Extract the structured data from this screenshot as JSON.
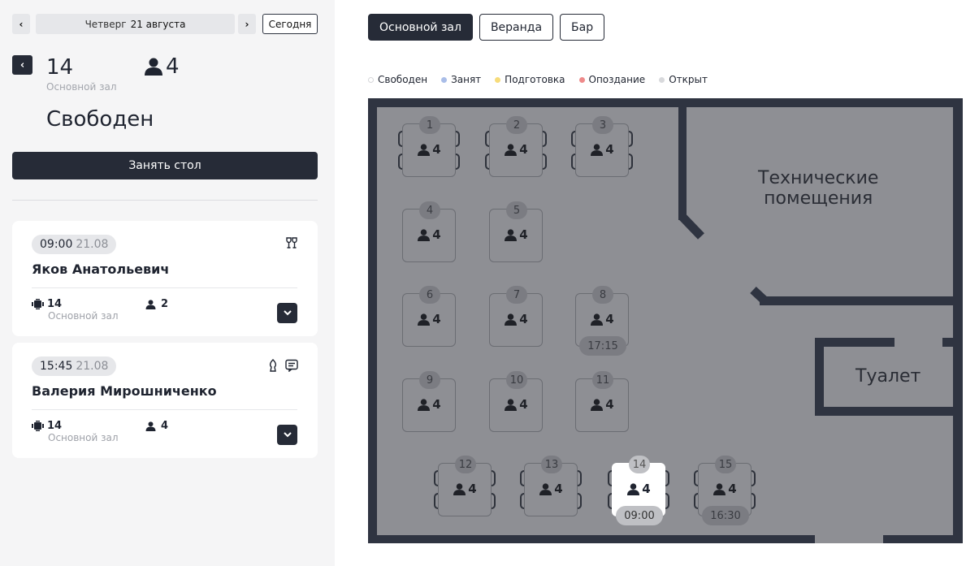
{
  "date_nav": {
    "prev": "‹",
    "next": "›",
    "weekday": "Четверг",
    "date": "21 августа",
    "today_label": "Сегодня"
  },
  "selected_table": {
    "back": "‹",
    "number": "14",
    "hall": "Основной зал",
    "seats": "4",
    "status": "Свободен",
    "action_label": "Занять стол"
  },
  "reservations": [
    {
      "time": "09:00",
      "date": "21.08",
      "name": "Яков Анатольевич",
      "table": "14",
      "hall": "Основной зал",
      "guests": "2",
      "icons": [
        "wine-glasses-icon"
      ]
    },
    {
      "time": "15:45",
      "date": "21.08",
      "name": "Валерия Мирошниченко",
      "table": "14",
      "hall": "Основной зал",
      "guests": "4",
      "icons": [
        "candle-icon",
        "comment-icon"
      ]
    }
  ],
  "hall_tabs": [
    {
      "label": "Основной зал",
      "active": true
    },
    {
      "label": "Веранда",
      "active": false
    },
    {
      "label": "Бар",
      "active": false
    }
  ],
  "legend": [
    {
      "label": "Свободен",
      "color": "#ffffff"
    },
    {
      "label": "Занят",
      "color": "#a9bde8"
    },
    {
      "label": "Подготовка",
      "color": "#f7dc7a"
    },
    {
      "label": "Опоздание",
      "color": "#ee8a8a"
    },
    {
      "label": "Открыт",
      "color": "#d8d9dc"
    }
  ],
  "rooms": {
    "technical_line1": "Технические",
    "technical_line2": "помещения",
    "toilet": "Туалет"
  },
  "tables": [
    {
      "number": "1",
      "seats": "4",
      "time": "",
      "chairs": true
    },
    {
      "number": "2",
      "seats": "4",
      "time": "",
      "chairs": true
    },
    {
      "number": "3",
      "seats": "4",
      "time": "",
      "chairs": true
    },
    {
      "number": "4",
      "seats": "4",
      "time": "",
      "chairs": false
    },
    {
      "number": "5",
      "seats": "4",
      "time": "",
      "chairs": false
    },
    {
      "number": "6",
      "seats": "4",
      "time": "",
      "chairs": false
    },
    {
      "number": "7",
      "seats": "4",
      "time": "",
      "chairs": false
    },
    {
      "number": "8",
      "seats": "4",
      "time": "17:15",
      "chairs": false
    },
    {
      "number": "9",
      "seats": "4",
      "time": "",
      "chairs": false
    },
    {
      "number": "10",
      "seats": "4",
      "time": "",
      "chairs": false
    },
    {
      "number": "11",
      "seats": "4",
      "time": "",
      "chairs": false
    },
    {
      "number": "12",
      "seats": "4",
      "time": "",
      "chairs": true
    },
    {
      "number": "13",
      "seats": "4",
      "time": "",
      "chairs": true
    },
    {
      "number": "14",
      "seats": "4",
      "time": "09:00",
      "chairs": true,
      "selected": true
    },
    {
      "number": "15",
      "seats": "4",
      "time": "16:30",
      "chairs": true
    }
  ]
}
